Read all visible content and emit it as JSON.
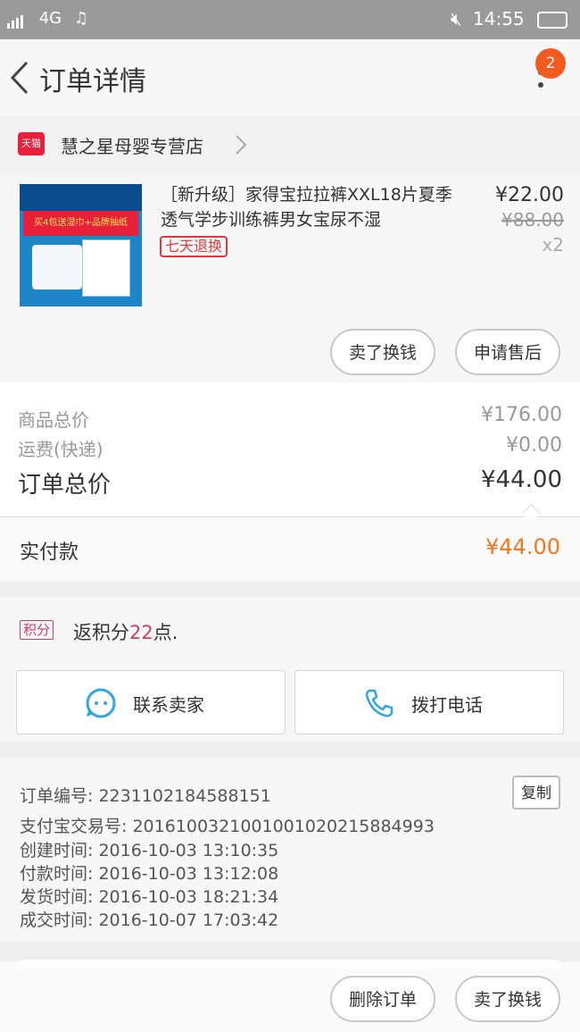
{
  "status_bar": {
    "network": "4G",
    "time": "14:55"
  },
  "header": {
    "title": "订单详情",
    "badge_count": "2"
  },
  "store": {
    "platform_tag": "天猫",
    "name": "慧之星母婴专营店"
  },
  "product": {
    "title": "［新升级］家得宝拉拉裤XXL18片夏季透气学步训练裤男女宝尿不湿",
    "tag": "七天退换",
    "price": "¥22.00",
    "original_price": "¥88.00",
    "quantity": "x2",
    "image_caption": "买4包送湿巾+品牌抽纸",
    "buttons": {
      "refund": "卖了换钱",
      "after_sale": "申请售后"
    }
  },
  "totals": {
    "goods_label": "商品总价",
    "goods_value": "¥176.00",
    "shipping_label": "运费(快递)",
    "shipping_value": "¥0.00",
    "order_label": "订单总价",
    "order_value": "¥44.00",
    "paid_label": "实付款",
    "paid_value": "¥44.00"
  },
  "points": {
    "tag": "积分",
    "text_prefix": "返积分",
    "value": "22",
    "text_suffix": "点."
  },
  "actions": {
    "contact_seller": "联系卖家",
    "call": "拨打电话"
  },
  "order_info": {
    "rows": [
      "订单编号: 2231102184588151",
      "支付宝交易号: 2016100321001001020215884993",
      "创建时间: 2016-10-03 13:10:35",
      "付款时间: 2016-10-03 13:12:08",
      "发货时间: 2016-10-03 18:21:34",
      "成交时间: 2016-10-07 17:03:42"
    ],
    "copy_label": "复制"
  },
  "footer": {
    "delete": "删除订单",
    "refund": "卖了换钱"
  },
  "colors": {
    "accent_orange": "#f0781e",
    "badge": "#f25b1f",
    "tmall_red": "#e8203b",
    "points_pink": "#d23b69",
    "icon_blue": "#2ea7e0"
  }
}
